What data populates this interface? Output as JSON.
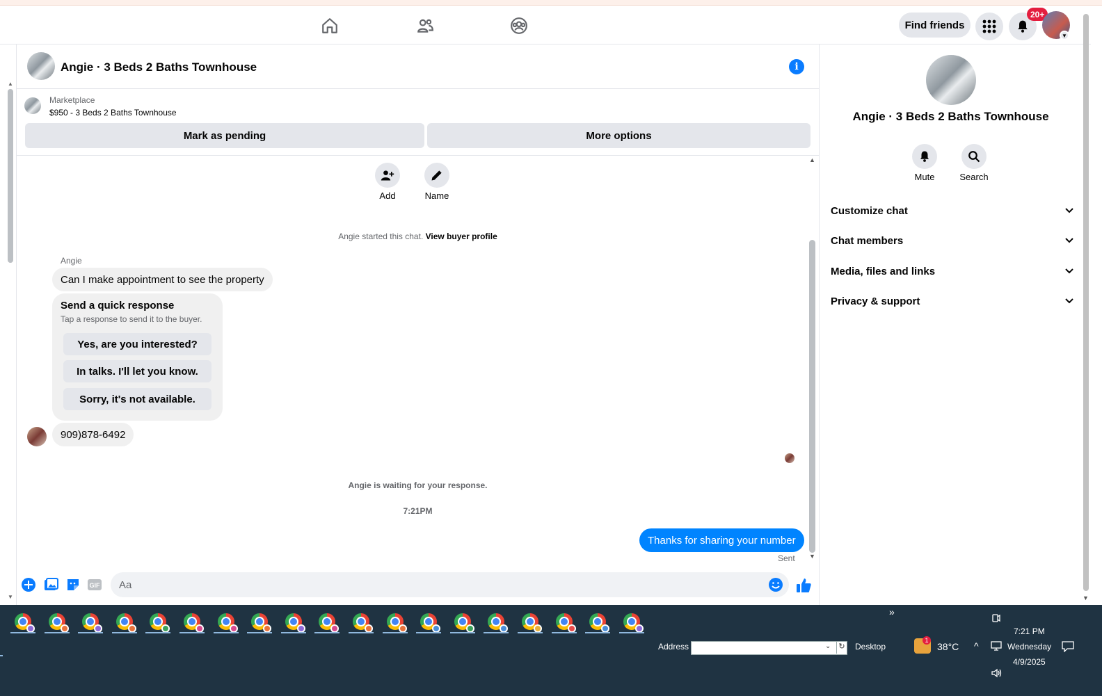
{
  "topbar": {
    "find_friends": "Find friends",
    "notification_count": "20+",
    "icons": [
      "home-icon",
      "friends-icon",
      "groups-icon",
      "menu-grid-icon",
      "bell-icon"
    ]
  },
  "chat": {
    "title": "Angie · 3 Beds 2 Baths Townhouse",
    "marketplace_label": "Marketplace",
    "listing": "$950 - 3 Beds 2 Baths Townhouse",
    "mark_pending": "Mark as pending",
    "more_options": "More options",
    "add_label": "Add",
    "name_label": "Name",
    "started_text": "Angie started this chat.",
    "view_buyer_profile": "View buyer profile",
    "sender_name": "Angie",
    "message1": "Can I make appointment to see the property",
    "quick_title": "Send a quick response",
    "quick_subtitle": "Tap a response to send it to the buyer.",
    "quick_responses": [
      "Yes, are you interested?",
      "In talks. I'll let you know.",
      "Sorry, it's not available."
    ],
    "message2": "909)878-6492",
    "waiting_text": "Angie is waiting for your response.",
    "timestamp": "7:21PM",
    "my_message": "Thanks for sharing your number",
    "sent_status": "Sent",
    "input_placeholder": "Aa",
    "input_value": ""
  },
  "right_panel": {
    "title": "Angie · 3 Beds 2 Baths Townhouse",
    "mute_label": "Mute",
    "search_label": "Search",
    "sections": [
      "Customize chat",
      "Chat members",
      "Media, files and links",
      "Privacy & support"
    ]
  },
  "taskbar": {
    "app_count": 19,
    "overflow": "»",
    "address_label": "Address",
    "address_value": "",
    "desktop_label": "Desktop",
    "weather_badge": "1",
    "temperature": "38°C",
    "time": "7:21 PM",
    "day": "Wednesday",
    "date": "4/9/2025"
  },
  "colors": {
    "accent": "#0084ff",
    "info": "#0a7cff",
    "badge": "#e41e3f",
    "taskbar": "#1f3342"
  }
}
